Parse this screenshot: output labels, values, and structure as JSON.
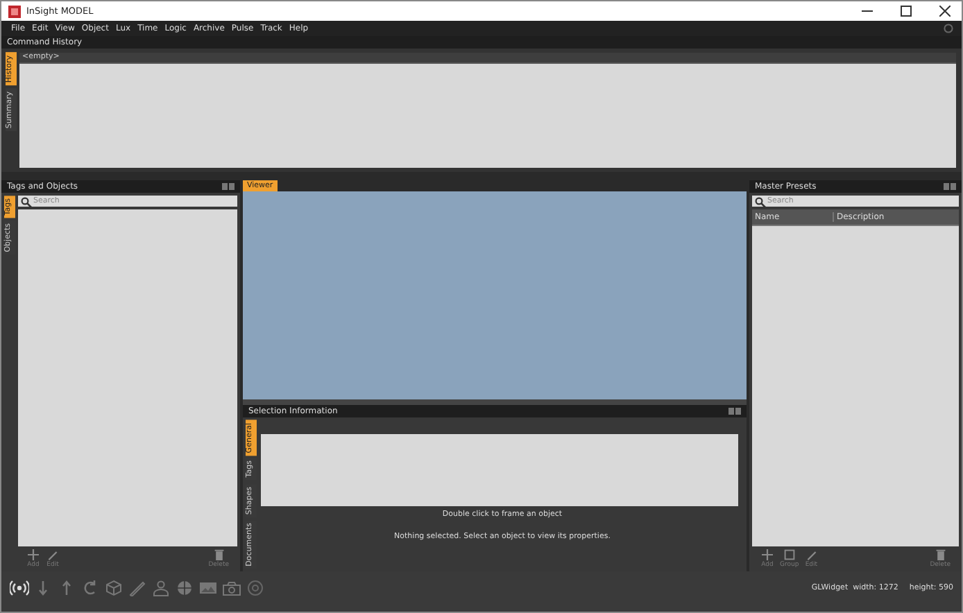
{
  "window": {
    "title": "InSight MODEL"
  },
  "menu": [
    "File",
    "Edit",
    "View",
    "Object",
    "Lux",
    "Time",
    "Logic",
    "Archive",
    "Pulse",
    "Track",
    "Help"
  ],
  "command_history": {
    "title": "Command History",
    "tabs": [
      {
        "label": "History",
        "selected": true
      },
      {
        "label": "Summary",
        "selected": false
      }
    ],
    "list_header": "<empty>"
  },
  "tags_panel": {
    "title": "Tags and Objects",
    "tabs": [
      {
        "label": "Tags",
        "selected": true
      },
      {
        "label": "Objects",
        "selected": false
      }
    ],
    "search": {
      "placeholder": "Search"
    },
    "buttons": [
      {
        "kind": "add",
        "label": "Add"
      },
      {
        "kind": "edit",
        "label": "Edit"
      },
      {
        "kind": "delete",
        "label": "Delete"
      }
    ]
  },
  "viewer": {
    "tabs": [
      {
        "label": "Viewer",
        "selected": true
      }
    ]
  },
  "selection_panel": {
    "title": "Selection Information",
    "tabs": [
      {
        "label": "General",
        "selected": true
      },
      {
        "label": "Tags",
        "selected": false
      },
      {
        "label": "Shapes",
        "selected": false
      },
      {
        "label": "Documents",
        "selected": false
      }
    ],
    "hint": "Double click to frame an object",
    "message": "Nothing selected. Select an object to view its properties."
  },
  "presets_panel": {
    "title": "Master Presets",
    "search": {
      "placeholder": "Search"
    },
    "columns": [
      "Name",
      "Description"
    ],
    "buttons": [
      {
        "kind": "add",
        "label": "Add"
      },
      {
        "kind": "group",
        "label": "Group"
      },
      {
        "kind": "edit",
        "label": "Edit"
      },
      {
        "kind": "delete",
        "label": "Delete"
      }
    ]
  },
  "toolbar": [
    {
      "kind": "broadcast"
    },
    {
      "kind": "down"
    },
    {
      "kind": "up"
    },
    {
      "kind": "refresh"
    },
    {
      "kind": "cube"
    },
    {
      "kind": "pencil"
    },
    {
      "kind": "person"
    },
    {
      "kind": "globe"
    },
    {
      "kind": "image"
    },
    {
      "kind": "camera"
    },
    {
      "kind": "target"
    }
  ],
  "status_bar": {
    "widget": "GLWidget  width: 1272",
    "height": "height: 590"
  }
}
